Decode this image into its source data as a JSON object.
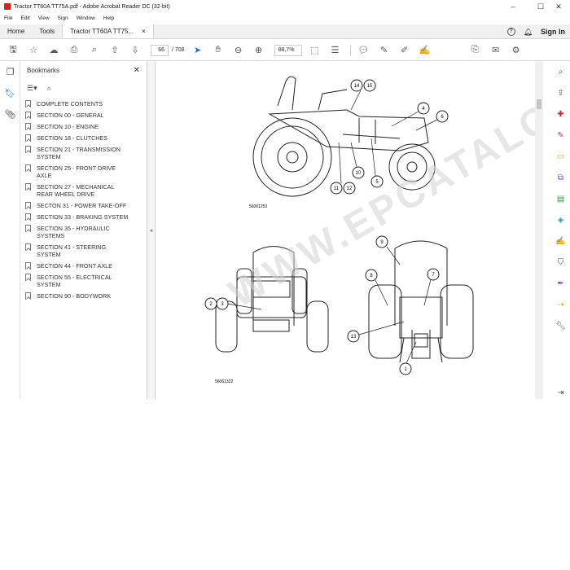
{
  "window": {
    "title": "Tractor TT60A TT75A.pdf - Adobe Acrobat Reader DC (32-bit)"
  },
  "menu": [
    "File",
    "Edit",
    "View",
    "Sign",
    "Window",
    "Help"
  ],
  "tabs": {
    "home": "Home",
    "tools": "Tools",
    "doc": "Tractor TT60A TT75...",
    "close": "×"
  },
  "header": {
    "help": "?",
    "signin": "Sign In"
  },
  "toolbar": {
    "page_current": "66",
    "page_total": "/ 708",
    "zoom": "88,7%"
  },
  "bookmarks": {
    "title": "Bookmarks",
    "items": [
      "COMPLETE CONTENTS",
      "SECTION 00 - GENERAL",
      "SECTION 10 - ENGINE",
      "SECTION 18 - CLUTCHES",
      "SECTION 21 - TRANSMISSION SYSTEM",
      "SECTION 25 - FRONT DRIVE AXLE",
      "SECTION 27 - MECHANICAL REAR WHEEL DRIVE",
      "SECTON 31 - POWER TAKE-OFF",
      "SECTION 33 - BRAKING SYSTEM",
      "SECTION 35 - HYDRAULIC SYSTEMS",
      "SECTION 41 - STEERING SYSTEM",
      "SECTION 44 - FRONT AXLE",
      "SECTION 55 - ELECTRICAL SYSTEM",
      "SECTION 90 - BODYWORK"
    ]
  },
  "drawing": {
    "fig1_code": "56061253",
    "fig2_code": "56061322",
    "callouts_fig1": [
      "14",
      "15",
      "4",
      "6",
      "10",
      "11",
      "12",
      "5"
    ],
    "callouts_fig2": [
      "2",
      "3"
    ],
    "callouts_fig3": [
      "9",
      "8",
      "7",
      "13",
      "1"
    ]
  },
  "watermark": "WWW.EPCATALOGS.COM",
  "colors": {
    "accent": "#1473e6",
    "pdf_red": "#d8211d",
    "icon_gray": "#555555"
  }
}
